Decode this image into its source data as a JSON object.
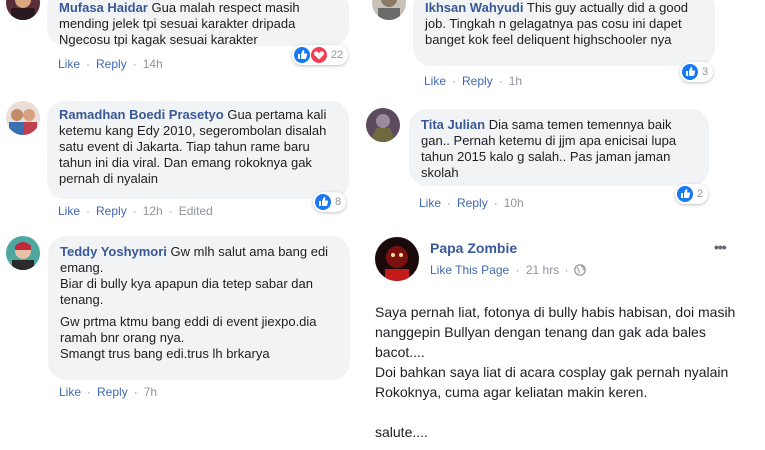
{
  "comments": [
    {
      "author": "Mufasa Haidar",
      "text": "Gua malah respect masih mending jelek tpi sesuai karakter dripada Ngecosu tpi kagak sesuai karakter",
      "actions": {
        "like": "Like",
        "reply": "Reply",
        "time": "14h"
      },
      "reactions": {
        "count": "22",
        "types": [
          "like-icon",
          "love-icon"
        ]
      }
    },
    {
      "author": "Ikhsan Wahyudi",
      "text": "This guy actually did a good job. Tingkah n gelagatnya pas cosu ini dapet banget kok feel deliquent highschooler nya",
      "actions": {
        "like": "Like",
        "reply": "Reply",
        "time": "1h"
      },
      "reactions": {
        "count": "3",
        "types": [
          "like-icon"
        ]
      }
    },
    {
      "author": "Ramadhan Boedi Prasetyo",
      "text": "Gua pertama kali ketemu kang Edy 2010, segerombolan disalah satu event di Jakarta. Tiap tahun rame baru tahun ini dia viral. Dan emang rokoknya gak pernah di nyalain",
      "actions": {
        "like": "Like",
        "reply": "Reply",
        "time": "12h",
        "edited": "Edited"
      },
      "reactions": {
        "count": "8",
        "types": [
          "like-icon"
        ]
      }
    },
    {
      "author": "Tita Julian",
      "text": "Dia sama temen temennya baik gan.. Pernah ketemu di jjm apa enicisai lupa tahun 2015 kalo g salah.. Pas jaman jaman skolah",
      "actions": {
        "like": "Like",
        "reply": "Reply",
        "time": "10h"
      },
      "reactions": {
        "count": "2",
        "types": [
          "like-icon"
        ]
      }
    },
    {
      "author": "Teddy Yoshymori",
      "text": "Gw mlh salut ama bang edi emang.",
      "text2": "Biar di bully kya apapun dia tetep sabar dan tenang.",
      "text3": "Gw prtma ktmu bang eddi di event jiexpo.dia ramah bnr orang nya.",
      "text4": "Smangt trus bang edi.trus lh brkarya",
      "actions": {
        "like": "Like",
        "reply": "Reply",
        "time": "7h"
      }
    }
  ],
  "post": {
    "author": "Papa Zombie",
    "like_page": "Like This Page",
    "time": "21 hrs",
    "more": "•••",
    "lines": [
      "Saya pernah liat, fotonya di bully habis habisan, doi masih nanggepin Bullyan dengan tenang dan gak ada bales bacot....",
      "Doi bahkan saya liat di acara cosplay gak pernah nyalain Rokoknya, cuma agar keliatan makin keren.",
      "",
      "salute...."
    ]
  },
  "colors": {
    "link": "#4267b2",
    "name": "#385898",
    "bubble": "#f2f3f5",
    "like": "#1877f2",
    "love": "#f33e58"
  }
}
